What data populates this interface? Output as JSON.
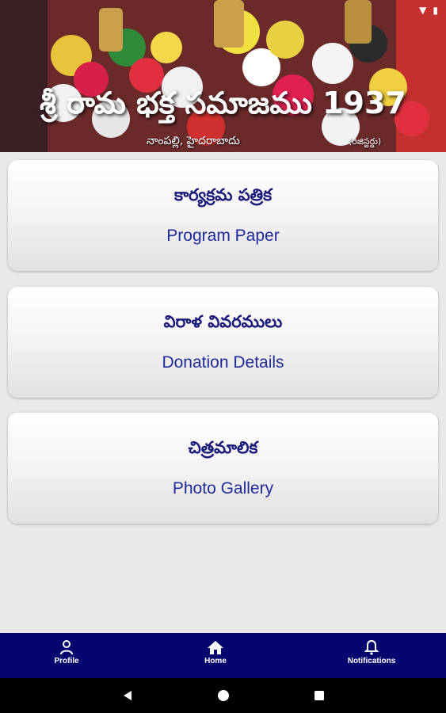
{
  "status_bar": {
    "icons": [
      "wifi-icon",
      "battery-icon"
    ]
  },
  "header": {
    "title": "శ్రీ రామ భక్త సమాజము 1937",
    "subtitle": "నాంపల్లి, హైదరాబాదు",
    "registered": "(రిజిస్టర్డు)"
  },
  "menu": [
    {
      "title_te": "కార్యక్రమ పత్రిక",
      "title_en": "Program Paper"
    },
    {
      "title_te": "విరాళ వివరములు",
      "title_en": "Donation Details"
    },
    {
      "title_te": "చిత్రమాలిక",
      "title_en": "Photo Gallery"
    }
  ],
  "bottom_nav": [
    {
      "label": "Profile",
      "icon": "person-icon"
    },
    {
      "label": "Home",
      "icon": "home-icon"
    },
    {
      "label": "Notifications",
      "icon": "bell-icon"
    }
  ],
  "system_nav": [
    "back-icon",
    "home-circle-icon",
    "recents-icon"
  ],
  "colors": {
    "nav_bg": "#050570",
    "text_te": "#1a1a7a",
    "text_en": "#1f2a9a",
    "page_bg": "#e9e9e9"
  }
}
